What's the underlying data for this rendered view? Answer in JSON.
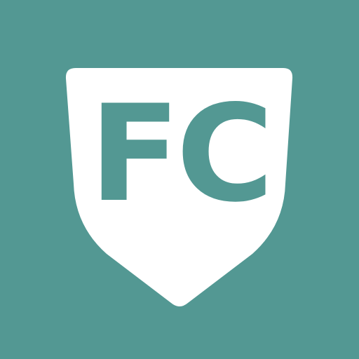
{
  "logo": {
    "monogram": "FC",
    "icon": "shield-icon"
  },
  "colors": {
    "background": "#539893",
    "shield": "#FFFFFF",
    "monogram": "#539893"
  }
}
